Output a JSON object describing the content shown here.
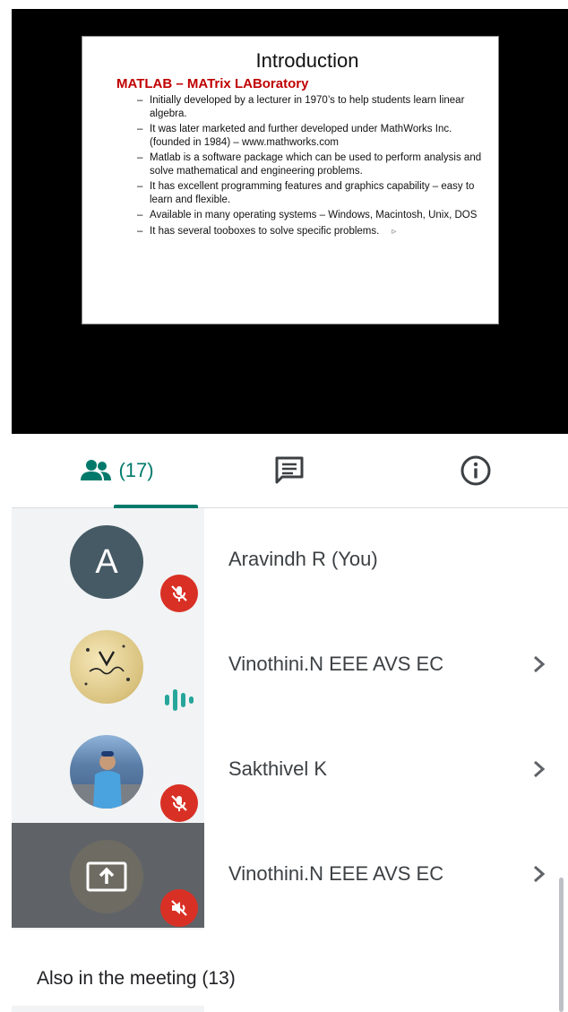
{
  "slide": {
    "title": "Introduction",
    "subtitle": "MATLAB – MATrix LABoratory",
    "bullets": [
      "Initially developed by a lecturer in 1970’s to help  students learn linear algebra.",
      "It was later marketed and further developed under MathWorks Inc. (founded in 1984) – www.mathworks.com",
      "Matlab is a software package which can be used to perform analysis and solve mathematical and engineering problems.",
      "It has excellent programming features and graphics capability – easy to learn and flexible.",
      "Available in many operating systems – Windows, Macintosh, Unix, DOS",
      "It has several tooboxes to solve specific problems."
    ]
  },
  "tabs": {
    "people_count": "(17)",
    "people_icon": "people-icon",
    "chat_icon": "chat-icon",
    "info_icon": "info-icon"
  },
  "colors": {
    "accent": "#00796b",
    "mute": "#d93025",
    "avatar_letter_bg": "#455a64"
  },
  "participants": [
    {
      "name": "Aravindh R (You)",
      "avatar_letter": "A",
      "status": "muted"
    },
    {
      "name": "Vinothini.N EEE AVS EC",
      "status": "speaking"
    },
    {
      "name": "Sakthivel K",
      "status": "muted"
    },
    {
      "name": "Vinothini.N EEE AVS EC",
      "status": "presenting-muted"
    }
  ],
  "also_in_meeting": "Also in the meeting (13)"
}
